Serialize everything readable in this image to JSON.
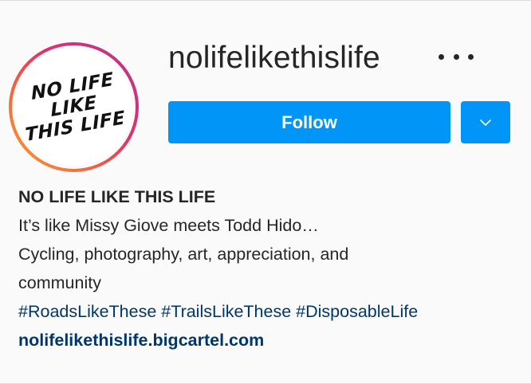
{
  "profile": {
    "username": "nolifelikethislife",
    "avatar_logo_lines": [
      "NO LIFE",
      "LIKE",
      "THIS LIFE"
    ],
    "follow_label": "Follow",
    "more_icon": "more-horizontal-icon",
    "dropdown_icon": "chevron-down-icon"
  },
  "bio": {
    "full_name": "NO LIFE LIKE THIS LIFE",
    "line1": "It’s like Missy Giove meets Todd Hido…",
    "line2": "Cycling, photography, art, appreciation, and",
    "line3": "community",
    "hashtags": "#RoadsLikeThese #TrailsLikeThese #DisposableLife",
    "website": "nolifelikethislife.bigcartel.com"
  },
  "colors": {
    "primary_button": "#0095f6",
    "link": "#00376b",
    "text": "#262626",
    "background": "#fafafa"
  }
}
